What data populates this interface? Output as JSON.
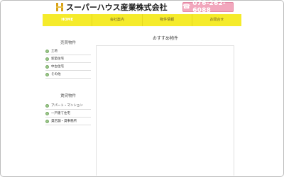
{
  "header": {
    "company_name": "スーパーハウス産業株式会社",
    "phone": "076-262-6088",
    "logo_icon": "house-logo-icon",
    "phone_icon": "telephone-icon",
    "phone_bg_color": "#f2a7bd"
  },
  "nav": {
    "bg_color": "#f5eb2b",
    "items": [
      {
        "label": "HOME"
      },
      {
        "label": "会社案内"
      },
      {
        "label": "物件情報"
      },
      {
        "label": "お問合せ"
      }
    ]
  },
  "sidebar": {
    "sale": {
      "title": "売買物件",
      "items": [
        {
          "label": "土地"
        },
        {
          "label": "新築住宅"
        },
        {
          "label": "中古住宅"
        },
        {
          "label": "その他"
        }
      ]
    },
    "rent": {
      "title": "賃貸物件",
      "items": [
        {
          "label": "アパート・マンション"
        },
        {
          "label": "一戸建て住宅"
        },
        {
          "label": "貸店舗・貸事務所"
        }
      ]
    }
  },
  "main": {
    "title": "おすすめ物件"
  }
}
